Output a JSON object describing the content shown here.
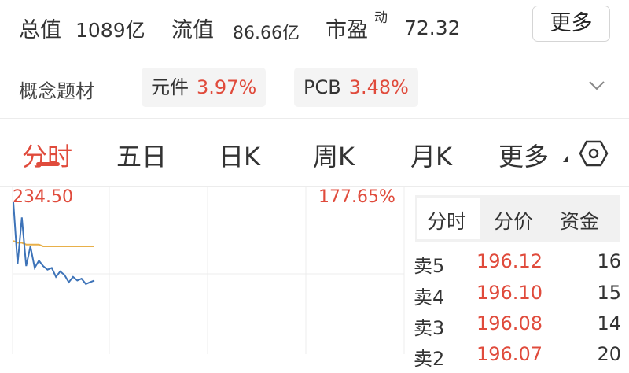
{
  "stats": {
    "total_cap_label": "总值",
    "total_cap_value": "1089亿",
    "float_cap_label": "流值",
    "float_cap_value": "86.66亿",
    "pe_label": "市盈",
    "pe_sup": "动",
    "pe_value": "72.32",
    "more_button": "更多"
  },
  "concept": {
    "label": "概念题材",
    "chips": [
      {
        "name": "元件",
        "change": "3.97%"
      },
      {
        "name": "PCB",
        "change": "3.48%"
      }
    ],
    "expand_icon": "chevron-down-icon"
  },
  "tabs": {
    "items": [
      "分时",
      "五日",
      "日K",
      "周K",
      "月K",
      "更多"
    ],
    "active": "分时",
    "settings_icon": "hexagon-settings-icon"
  },
  "chart": {
    "price_high": "234.50",
    "pct_high": "177.65%"
  },
  "chart_data": {
    "type": "line",
    "series": [
      {
        "values": [
          234.5,
          200,
          226,
          199,
          210,
          198,
          202,
          199,
          197,
          198,
          193,
          196,
          194,
          190,
          193,
          191,
          192,
          189,
          190,
          191
        ]
      },
      {
        "values": [
          213,
          212,
          212,
          211,
          211,
          211,
          211,
          210,
          210,
          210,
          210,
          210,
          210,
          210,
          210,
          210,
          210,
          210,
          210,
          210
        ]
      }
    ]
  },
  "panel": {
    "tabs": [
      "分时",
      "分价",
      "资金"
    ],
    "active": "分时",
    "orders": [
      {
        "label": "卖5",
        "price": "196.12",
        "volume": "16"
      },
      {
        "label": "卖4",
        "price": "196.10",
        "volume": "15"
      },
      {
        "label": "卖3",
        "price": "196.08",
        "volume": "14"
      },
      {
        "label": "卖2",
        "price": "196.07",
        "volume": "20"
      }
    ]
  },
  "colors": {
    "accent_red": "#e04b3c",
    "line_blue": "#3d73b8",
    "line_orange": "#e8b04a"
  }
}
